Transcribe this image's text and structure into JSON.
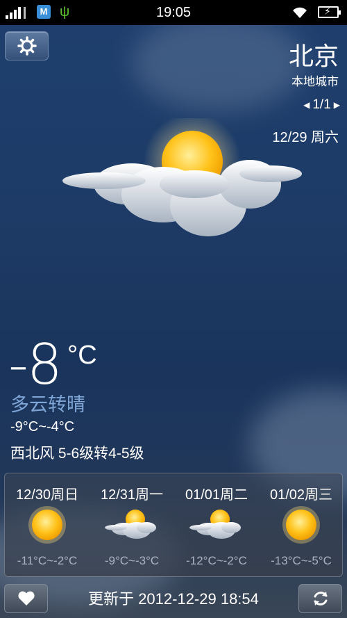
{
  "status_bar": {
    "time": "19:05",
    "app_badge": "M"
  },
  "header": {
    "city": "北京",
    "city_subtitle": "本地城市",
    "pager": "1/1",
    "date": "12/29 周六"
  },
  "current": {
    "temperature": "-8",
    "unit": "°C",
    "condition": "多云转晴",
    "range": "-9°C~-4°C",
    "wind": "西北风 5-6级转4-5级",
    "icon": "partly-cloudy-icon"
  },
  "forecast": [
    {
      "date": "12/30周日",
      "range": "-11°C~-2°C",
      "icon": "sun-icon"
    },
    {
      "date": "12/31周一",
      "range": "-9°C~-3°C",
      "icon": "partly-cloudy-icon"
    },
    {
      "date": "01/01周二",
      "range": "-12°C~-2°C",
      "icon": "partly-cloudy-icon"
    },
    {
      "date": "01/02周三",
      "range": "-13°C~-5°C",
      "icon": "sun-icon"
    }
  ],
  "footer": {
    "updated": "更新于 2012-12-29 18:54"
  },
  "colors": {
    "condition_text": "#7fa6d6",
    "forecast_range_text": "#a9b3bf",
    "usb_icon": "#58c12c"
  }
}
